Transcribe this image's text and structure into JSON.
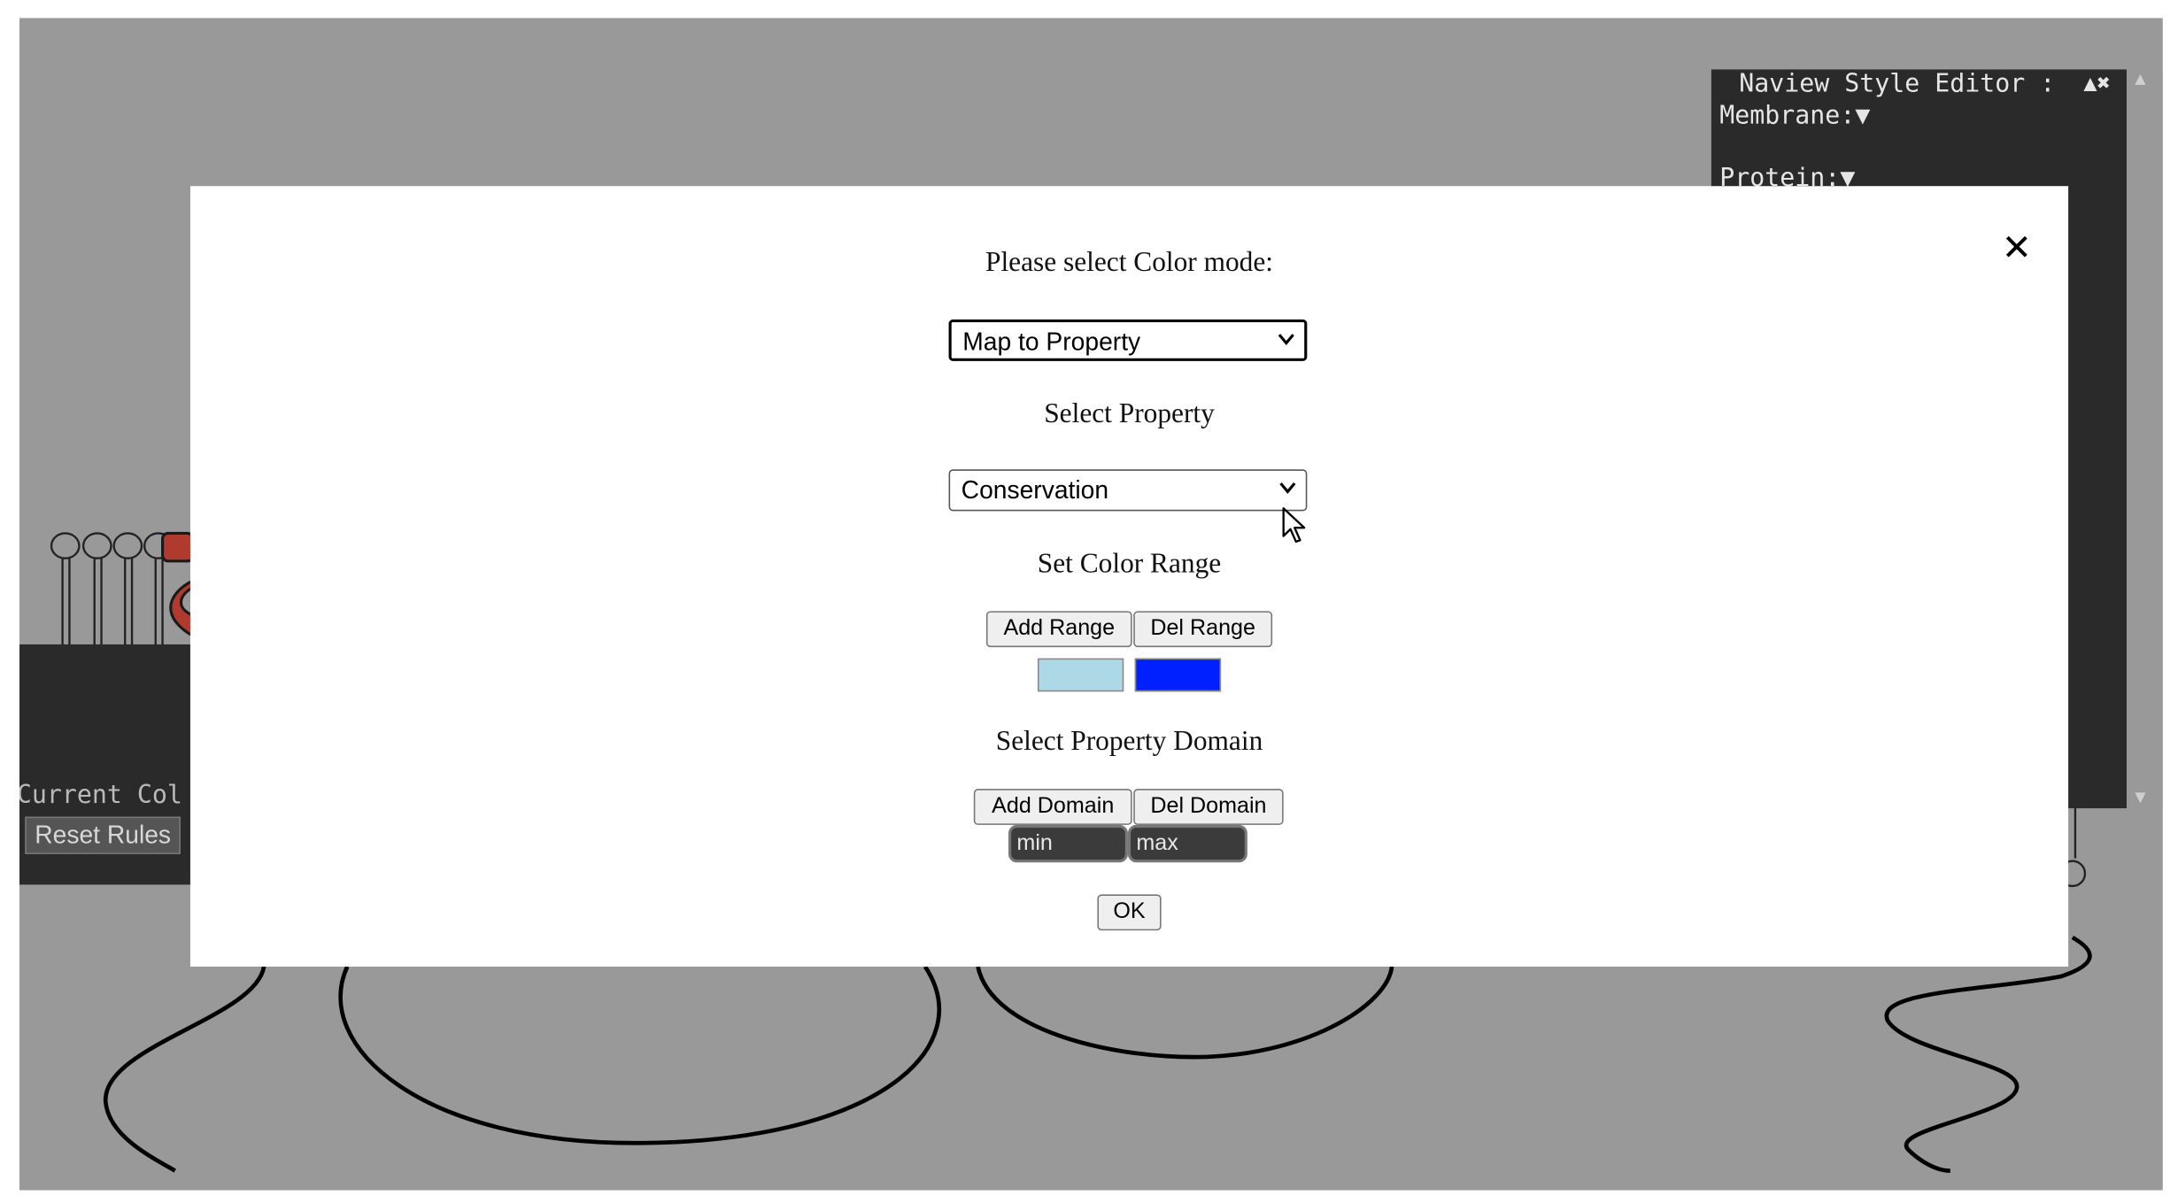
{
  "style_editor": {
    "title": "Naview Style Editor :",
    "controls": "▲✖",
    "membrane_label": "Membrane:▼",
    "protein_label": "Protein:▼"
  },
  "left_panel": {
    "current_color_label": "Current Col",
    "reset_rules_label": "Reset Rules"
  },
  "modal": {
    "close_label": "✕",
    "color_mode_prompt": "Please select Color mode:",
    "color_mode_value": "Map to Property",
    "select_property_label": "Select Property",
    "property_value": "Conservation",
    "set_color_range_label": "Set Color Range",
    "add_range_label": "Add Range",
    "del_range_label": "Del Range",
    "range_colors": [
      "#add8e6",
      "#0020ff"
    ],
    "select_domain_label": "Select Property Domain",
    "add_domain_label": "Add Domain",
    "del_domain_label": "Del Domain",
    "min_placeholder": "min",
    "max_placeholder": "max",
    "ok_label": "OK"
  },
  "colors": {
    "canvas_bg": "#999999",
    "panel_bg": "#2a2a2a",
    "helix_red": "#b03a2e"
  }
}
